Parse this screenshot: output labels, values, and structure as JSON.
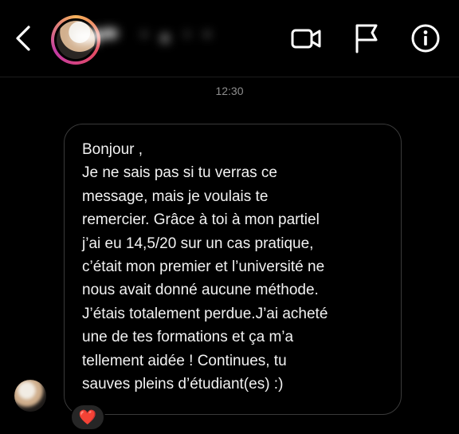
{
  "header": {
    "contact_name": "",
    "icons": [
      "chevron-left-icon",
      "video-camera-icon",
      "flag-icon",
      "info-icon"
    ]
  },
  "conversation": {
    "timestamp": "12:30",
    "message": {
      "lines": [
        "Bonjour ,",
        "Je ne sais pas si tu verras ce",
        "message, mais je voulais te",
        "remercier. Grâce à toi à mon partiel",
        "j’ai eu 14,5/20 sur un cas pratique,",
        "c’était mon premier et l’université ne",
        "nous avait donné aucune méthode.",
        "J’étais totalement perdue.J’ai acheté",
        "une de tes formations et ça m’a",
        "tellement aidée ! Continues, tu",
        "sauves pleins d’étudiant(es) :)"
      ],
      "reaction": "❤️"
    }
  },
  "colors": {
    "background": "#000000",
    "bubble_border": "#3a3a3a",
    "timestamp": "#8e8e8e",
    "heart": "#ff2d55"
  }
}
